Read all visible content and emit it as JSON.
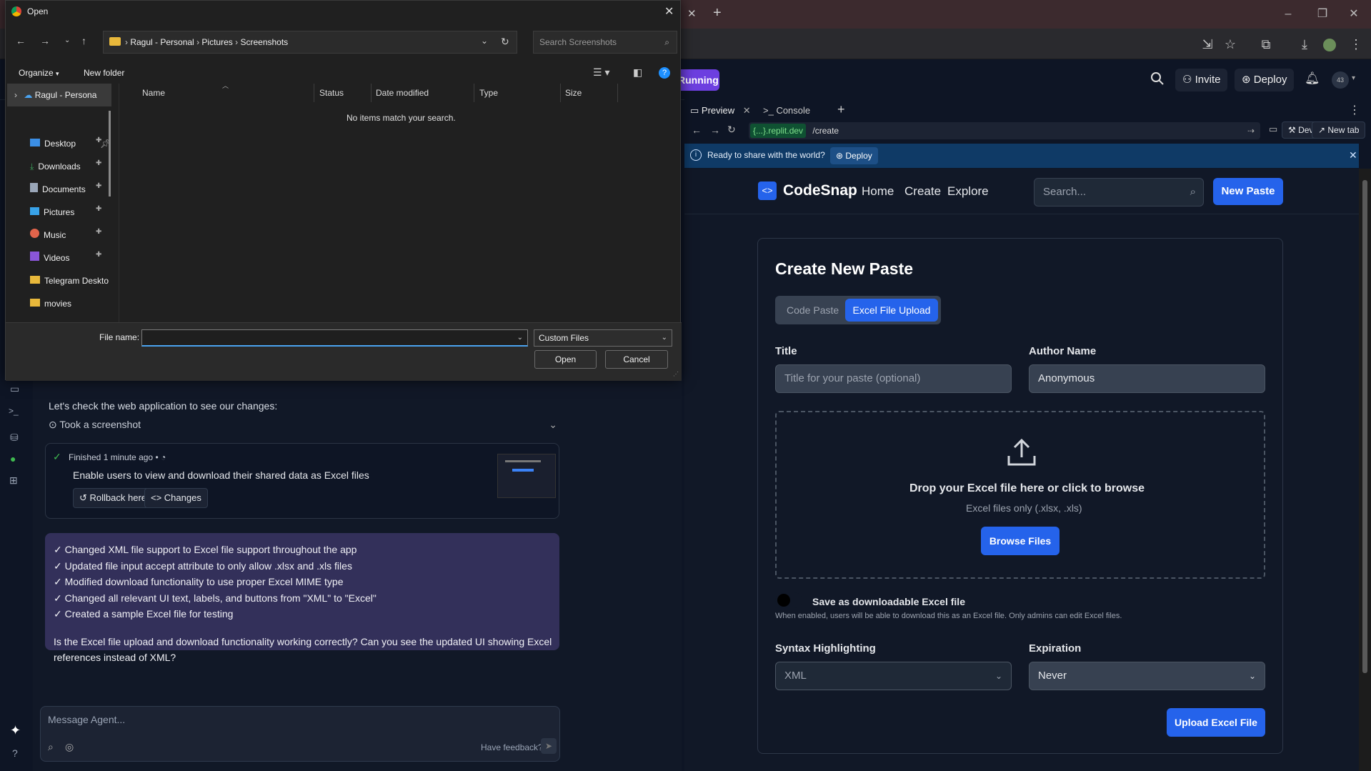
{
  "browser": {
    "window_controls": {
      "minimize": "–",
      "restore": "❐",
      "close": "✕"
    }
  },
  "replit": {
    "status": "Running",
    "invite_label": "Invite",
    "deploy_label": "Deploy",
    "avatar_text": "43",
    "tabs": [
      {
        "label": "Preview"
      },
      {
        "label": "Console"
      }
    ],
    "url_host": "{...}.replit.dev",
    "url_path": "/create",
    "devtools_label": "Devtools",
    "new_tab_label": "New tab",
    "banner_text": "Ready to share with the world?",
    "banner_deploy": "Deploy"
  },
  "app": {
    "brand": "CodeSnap",
    "nav": [
      "Home",
      "Create",
      "Explore"
    ],
    "search_placeholder": "Search...",
    "new_paste": "New Paste",
    "heading": "Create New Paste",
    "mode_tabs": [
      "Code Paste",
      "Excel File Upload"
    ],
    "title_label": "Title",
    "title_placeholder": "Title for your paste (optional)",
    "author_label": "Author Name",
    "author_value": "Anonymous",
    "drop_title": "Drop your Excel file here or click to browse",
    "drop_sub": "Excel files only (.xlsx, .xls)",
    "browse_button": "Browse Files",
    "toggle_label": "Save as downloadable Excel file",
    "toggle_help": "When enabled, users will be able to download this as an Excel file. Only admins can edit Excel files.",
    "syntax_label": "Syntax Highlighting",
    "syntax_value": "XML",
    "expiration_label": "Expiration",
    "expiration_value": "Never",
    "upload_button": "Upload Excel File"
  },
  "agent": {
    "intro": "Let's check the web application to see our changes:",
    "screenshot_label": "Took a screenshot",
    "finished_text": "Finished",
    "finished_time": "1 minute ago",
    "finished_sep": "•",
    "checkpoint_title": "Enable users to view and download their shared data as Excel files",
    "rollback": "Rollback here",
    "changes": "Changes",
    "summary": [
      "✓ Changed XML file support to Excel file support throughout the app",
      "✓ Updated file input accept attribute to only allow .xlsx and .xls files",
      "✓ Modified download functionality to use proper Excel MIME type",
      "✓ Changed all relevant UI text, labels, and buttons from \"XML\" to \"Excel\"",
      "✓ Created a sample Excel file for testing"
    ],
    "question": "Is the Excel file upload and download functionality working correctly? Can you see the updated UI showing Excel references instead of XML?",
    "message_placeholder": "Message Agent...",
    "feedback": "Have feedback?"
  },
  "dialog": {
    "title": "Open",
    "breadcrumb": [
      "Ragul - Personal",
      "Pictures",
      "Screenshots"
    ],
    "search_placeholder": "Search Screenshots",
    "organize": "Organize",
    "new_folder": "New folder",
    "tree_root": "Ragul - Persona",
    "columns": [
      "Name",
      "Status",
      "Date modified",
      "Type",
      "Size"
    ],
    "empty_message": "No items match your search.",
    "nav_items": [
      {
        "label": "Desktop",
        "icon": "desktop-icon",
        "color": "#3b8fe6"
      },
      {
        "label": "Downloads",
        "icon": "download-icon",
        "color": "#3ca55c"
      },
      {
        "label": "Documents",
        "icon": "document-icon",
        "color": "#9aa6b8"
      },
      {
        "label": "Pictures",
        "icon": "pictures-icon",
        "color": "#38a2e8"
      },
      {
        "label": "Music",
        "icon": "music-icon",
        "color": "#e2644b"
      },
      {
        "label": "Videos",
        "icon": "video-icon",
        "color": "#8a56d8"
      },
      {
        "label": "Telegram Deskto",
        "icon": "folder-icon",
        "color": "#e8b83b"
      },
      {
        "label": "movies",
        "icon": "folder-icon",
        "color": "#e8b83b"
      }
    ],
    "file_name_label": "File name:",
    "file_name_value": "",
    "file_type": "Custom Files",
    "open_button": "Open",
    "cancel_button": "Cancel"
  },
  "colors": {
    "accent": "#2563eb",
    "running": "#6d3fe0",
    "banner": "#0f3a66"
  }
}
